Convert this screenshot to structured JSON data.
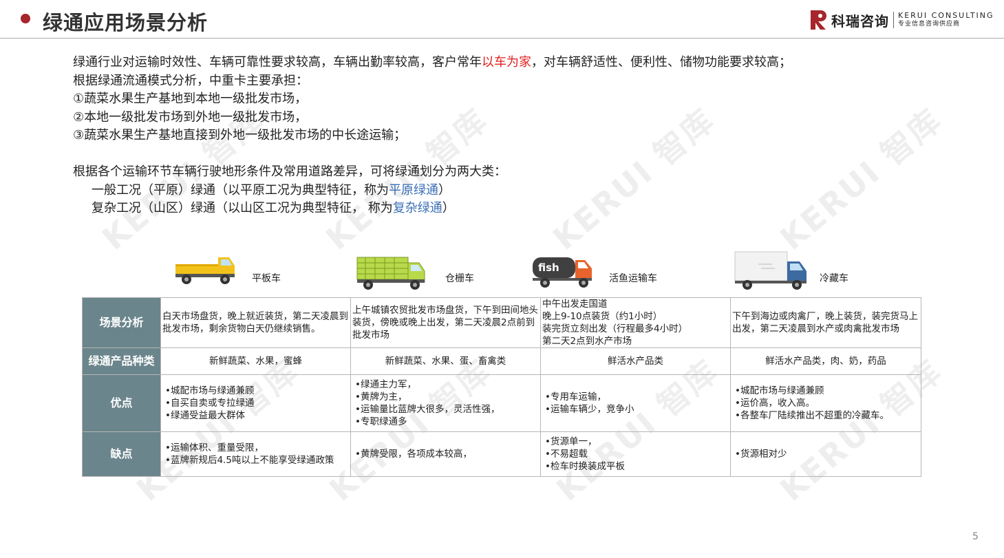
{
  "header": {
    "title": "绿通应用场景分析",
    "logo_cn": "科瑞咨询",
    "logo_en1": "KERUI CONSULTING",
    "logo_en2": "专业信息咨询供应商",
    "brand_color": "#a7262b"
  },
  "watermark": "KERUI 智库",
  "intro": {
    "line1_a": "绿通行业对运输时效性、车辆可靠性要求较高，车辆出勤率较高，客户常年",
    "line1_red": "以车为家",
    "line1_b": "，对车辆舒适性、便利性、储物功能要求较高；",
    "line2": "根据绿通流通模式分析，中重卡主要承担：",
    "line3": "①蔬菜水果生产基地到本地一级批发市场，",
    "line4": "②本地一级批发市场到外地一级批发市场，",
    "line5": "③蔬菜水果生产基地直接到外地一级批发市场的中长途运输；",
    "line6": "根据各个运输环节车辆行驶地形条件及常用道路差异，可将绿通划分为两大类：",
    "line7_a": "一般工况（平原）绿通（以平原工况为典型特征，称为",
    "line7_blue": "平原绿通",
    "line7_b": "）",
    "line8_a": "复杂工况（山区）绿通（以山区工况为典型特征， 称为",
    "line8_blue": "复杂绿通",
    "line8_b": "）"
  },
  "trucks": [
    {
      "label": "平板车",
      "icon": "flatbed-truck-icon"
    },
    {
      "label": "仓栅车",
      "icon": "stake-truck-icon"
    },
    {
      "label": "活鱼运输车",
      "icon": "fish-tank-truck-icon",
      "tank_text": "fish"
    },
    {
      "label": "冷藏车",
      "icon": "refrigerated-truck-icon"
    }
  ],
  "table": {
    "row_headers": [
      "场景分析",
      "绿通产品种类",
      "优点",
      "缺点"
    ],
    "scenario": [
      "白天市场盘货，晚上就近装货，第二天凌晨到批发市场，剩余货物白天仍继续销售。",
      "上午城镇农贸批发市场盘货，下午到田间地头装货，傍晚或晚上出发，第二天凌晨2点前到批发市场",
      [
        "中午出发走国道",
        "晚上9-10点装货（约1小时）",
        "装完货立刻出发（行程最多4小时）",
        "第二天2点到水产市场"
      ],
      "下午到海边或肉禽厂，晚上装货，装完货马上出发，第二天凌晨到水产或肉禽批发市场"
    ],
    "products": [
      "新鲜蔬菜、水果，蜜蜂",
      "新鲜蔬菜、水果、蛋、畜禽类",
      "鲜活水产品类",
      "鲜活水产品类，肉、奶，药品"
    ],
    "pros": [
      [
        "•城配市场与绿通兼顾",
        "•自买自卖或专拉绿通",
        "•绿通受益最大群体"
      ],
      [
        "•绿通主力军，",
        "•黄牌为主，",
        "•运输量比蓝牌大很多，灵活性强，",
        "•专职绿通多"
      ],
      [
        "•专用车运输，",
        "•运输车辆少，竞争小"
      ],
      [
        "•城配市场与绿通兼顾",
        "•运价高，收入高。",
        "•各整车厂陆续推出不超重的冷藏车。"
      ]
    ],
    "cons": [
      [
        "•运输体积、重量受限，",
        "•蓝牌新规后4.5吨以上不能享受绿通政策"
      ],
      [
        "•黄牌受限，各项成本较高，"
      ],
      [
        "•货源单一，",
        "•不易超载",
        "•检车时换装成平板"
      ],
      [
        "•货源相对少"
      ]
    ],
    "header_color": "#6b858c"
  },
  "page_number": "5"
}
